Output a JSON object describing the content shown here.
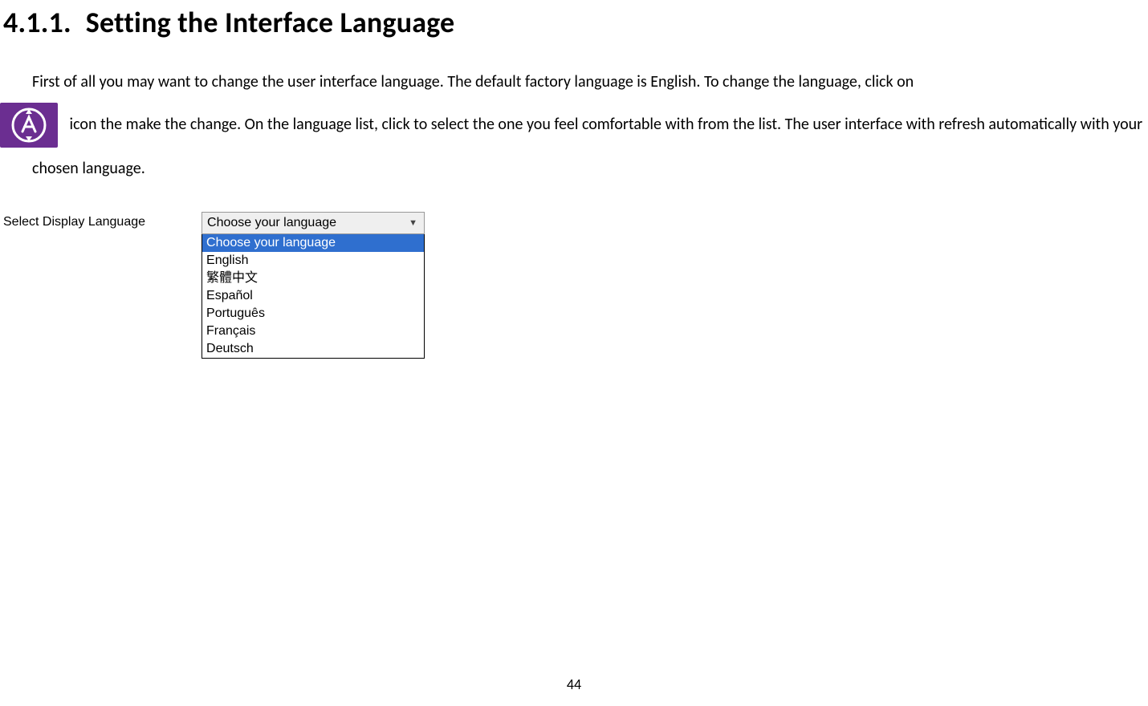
{
  "heading": {
    "number": "4.1.1.",
    "title": "Setting the Interface Language"
  },
  "para": {
    "s1": "First of all you may want to change the user interface language. The default factory language is English. To change the language, click on ",
    "s2": " icon the make the change. On the language list, click to select the one you feel comfortable with from the list. The user interface with refresh automatically with your chosen language."
  },
  "figure": {
    "label": "Select Display Language",
    "closed_value": "Choose your language",
    "options": [
      "Choose your language",
      "English",
      "繁體中文",
      "Español",
      "Português",
      "Français",
      "Deutsch"
    ],
    "selected_index": 0
  },
  "page_number": "44"
}
